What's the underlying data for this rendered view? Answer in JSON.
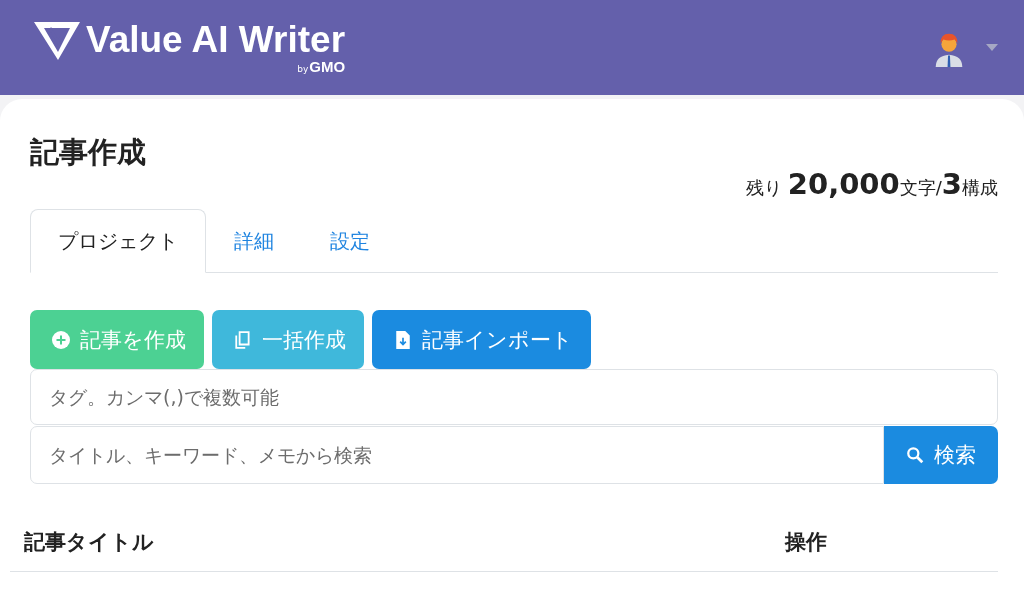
{
  "header": {
    "logo": {
      "name": "Value AI Writer",
      "byline_by": "by",
      "byline_brand": "GMO"
    }
  },
  "page": {
    "title": "記事作成",
    "remaining": "残り **20,000**文字/**3**構成"
  },
  "tabs": [
    {
      "label": "プロジェクト",
      "selected": true
    },
    {
      "label": "詳細",
      "selected": false
    },
    {
      "label": "設定",
      "selected": false
    }
  ],
  "actions": [
    {
      "kind": "add",
      "label": "記事を作成"
    },
    {
      "kind": "bulk",
      "label": "一括作成"
    },
    {
      "kind": "import",
      "label": "記事インポート"
    }
  ],
  "tag_field": {
    "placeholder": "タグ。カンマ(,)で複数可能"
  },
  "search": {
    "placeholder": "タイトル、キーワード、メモから検索",
    "button": "検索"
  },
  "table": {
    "columns": [
      "記事タイトル",
      "操作"
    ]
  }
}
